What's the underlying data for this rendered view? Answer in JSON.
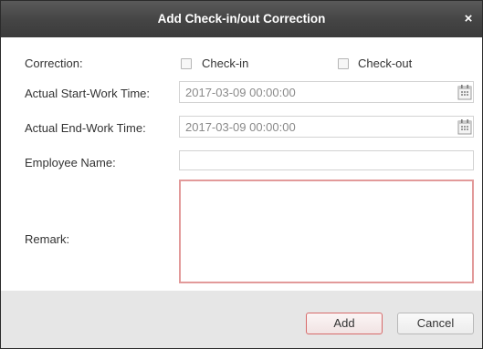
{
  "dialog": {
    "title": "Add Check-in/out Correction",
    "close_glyph": "×"
  },
  "form": {
    "correction_label": "Correction:",
    "checkin_label": "Check-in",
    "checkin_checked": false,
    "checkout_label": "Check-out",
    "checkout_checked": false,
    "start_label": "Actual Start-Work Time:",
    "start_value": "2017-03-09 00:00:00",
    "end_label": "Actual End-Work Time:",
    "end_value": "2017-03-09 00:00:00",
    "employee_label": "Employee Name:",
    "employee_value": "",
    "remark_label": "Remark:",
    "remark_value": ""
  },
  "buttons": {
    "add_label": "Add",
    "cancel_label": "Cancel"
  },
  "icons": {
    "start_calendar": "calendar-icon",
    "end_calendar": "calendar-icon"
  },
  "colors": {
    "titlebar": "#444444",
    "remark_border": "#e29a9a",
    "add_border": "#d76a6a",
    "footer": "#e6e6e6"
  }
}
